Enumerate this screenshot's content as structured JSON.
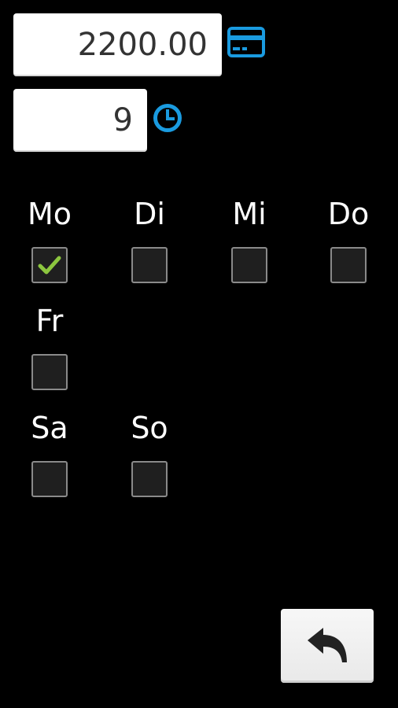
{
  "amount": {
    "value": "2200.00"
  },
  "hours": {
    "value": "9"
  },
  "icons": {
    "amount_icon": "credit-card-icon",
    "hours_icon": "clock-icon",
    "back_icon": "undo-arrow-icon"
  },
  "colors": {
    "accent": "#1a9be0",
    "check": "#8cc63f"
  },
  "days": [
    {
      "label": "Mo",
      "checked": true
    },
    {
      "label": "Di",
      "checked": false
    },
    {
      "label": "Mi",
      "checked": false
    },
    {
      "label": "Do",
      "checked": false
    },
    {
      "label": "Fr",
      "checked": false
    },
    {
      "label": "Sa",
      "checked": false
    },
    {
      "label": "So",
      "checked": false
    }
  ]
}
